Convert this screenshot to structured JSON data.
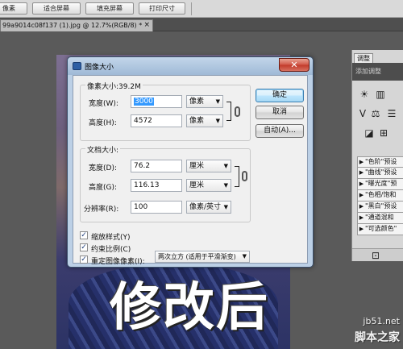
{
  "toolbar": {
    "buttons": [
      "像素",
      "适合屏幕",
      "填充屏幕",
      "打印尺寸"
    ]
  },
  "document_tab": {
    "title": "99a9014c08f137 (1).jpg @ 12.7%(RGB/8) *",
    "close": "×"
  },
  "canvas": {
    "caption": "修改后"
  },
  "dialog": {
    "title": "图像大小",
    "close_symbol": "✕",
    "pixel_group": {
      "legend": "像素大小:39.2M",
      "width_label": "宽度(W):",
      "width_value": "3000",
      "width_unit": "像素",
      "height_label": "高度(H):",
      "height_value": "4572",
      "height_unit": "像素"
    },
    "doc_group": {
      "legend": "文档大小:",
      "width_label": "宽度(D):",
      "width_value": "76.2",
      "width_unit": "厘米",
      "height_label": "高度(G):",
      "height_value": "116.13",
      "height_unit": "厘米",
      "resolution_label": "分辨率(R):",
      "resolution_value": "100",
      "resolution_unit": "像素/英寸"
    },
    "checkboxes": [
      {
        "label": "缩放样式(Y)",
        "checked": true
      },
      {
        "label": "约束比例(C)",
        "checked": true
      },
      {
        "label": "重定图像像素(I):",
        "checked": true
      }
    ],
    "resample_method": "两次立方 (适用于平滑渐变)",
    "buttons": {
      "ok": "确定",
      "cancel": "取消",
      "auto": "自动(A)..."
    }
  },
  "right_panel": {
    "tab": "调整",
    "header": "添加调整",
    "presets": [
      "\"色阶\"预设",
      "\"曲线\"预设",
      "\"曝光度\"预",
      "\"色相/饱和",
      "\"黑白\"预设",
      "\"通道混和",
      "\"可选颜色\""
    ]
  },
  "watermark": {
    "site": "jb51.net",
    "name": "脚本之家"
  }
}
